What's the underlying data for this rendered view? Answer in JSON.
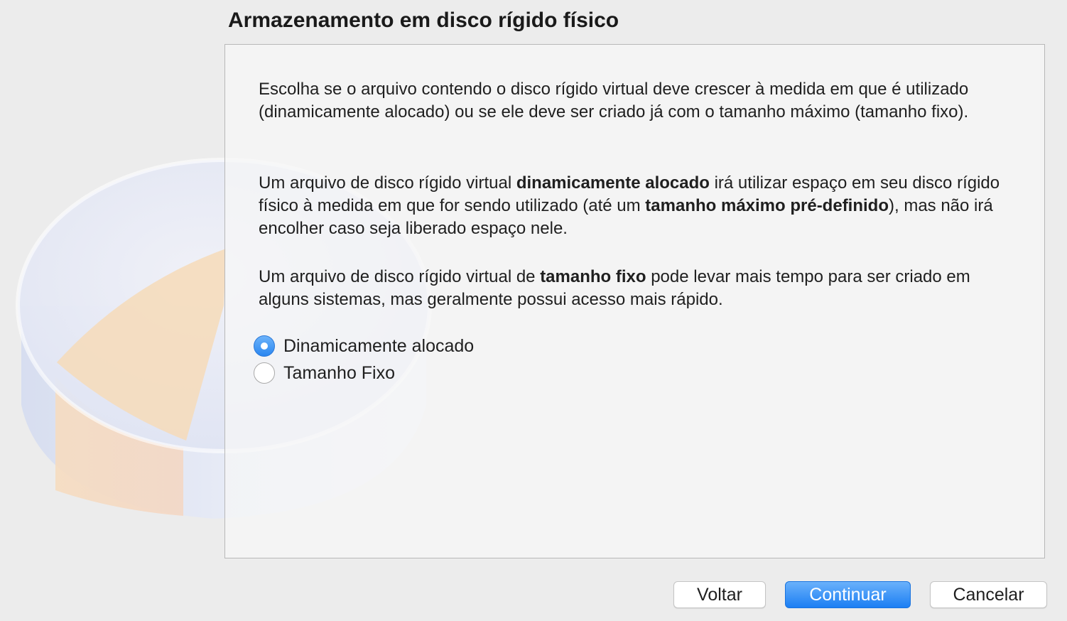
{
  "wizard": {
    "title": "Armazenamento em disco rígido físico"
  },
  "content": {
    "intro": "Escolha se o arquivo contendo o disco rígido virtual deve crescer à medida em que é utilizado (dinamicamente alocado) ou se ele deve ser criado já com o tamanho máximo (tamanho fixo).",
    "dynamic_para": {
      "part1": "Um arquivo de disco rígido virtual ",
      "bold1": "dinamicamente alocado",
      "part2": " irá utilizar espaço em seu disco rígido físico à medida em que for sendo utilizado (até um ",
      "bold2": "tamanho máximo pré-definido",
      "part3": "), mas não irá encolher caso seja liberado espaço nele."
    },
    "fixed_para": {
      "part1": "Um arquivo de disco rígido virtual de ",
      "bold1": "tamanho fixo",
      "part2": " pode levar mais tempo para ser criado em alguns sistemas, mas geralmente possui acesso mais rápido."
    }
  },
  "options": [
    {
      "label": "Dinamicamente alocado",
      "selected": true
    },
    {
      "label": "Tamanho Fixo",
      "selected": false
    }
  ],
  "buttons": {
    "back": "Voltar",
    "continue": "Continuar",
    "cancel": "Cancelar"
  },
  "colors": {
    "accent": "#2a86f0",
    "window_bg": "#ececec"
  }
}
